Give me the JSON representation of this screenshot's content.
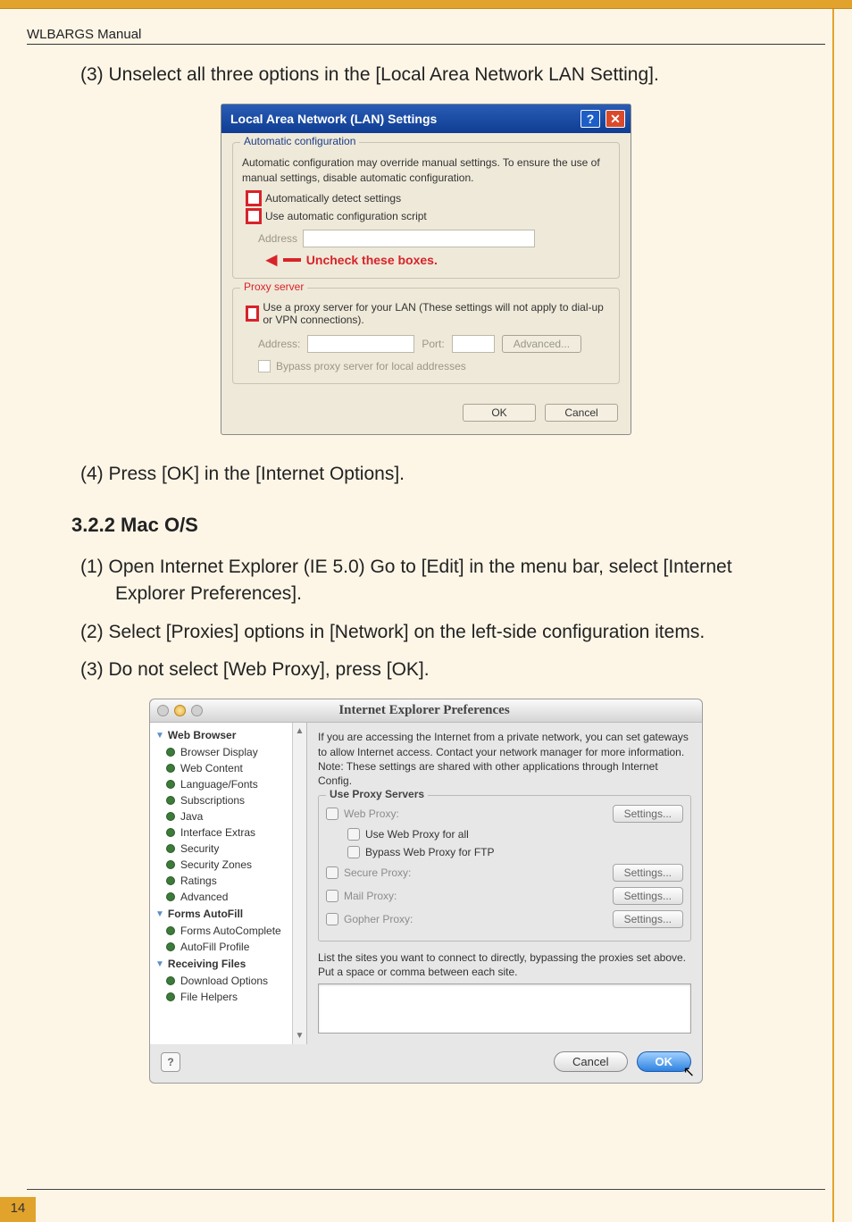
{
  "page": {
    "header_label": "WLBARGS Manual",
    "number": "14"
  },
  "instr3": "(3) Unselect all three options in the  [Local Area Network LAN Setting].",
  "instr4": "(4) Press [OK] in the [Internet Options].",
  "section_heading": "3.2.2 Mac O/S",
  "mac_steps": {
    "s1a": "(1) Open Internet Explorer (IE 5.0) Go to [Edit] in the menu bar, select [Internet",
    "s1b": "Explorer Preferences].",
    "s2": "(2) Select [Proxies] options in [Network] on the left-side configuration items.",
    "s3": "(3) Do not select [Web Proxy], press [OK]."
  },
  "lan": {
    "title": "Local Area Network (LAN) Settings",
    "help": "?",
    "close": "✕",
    "auto_legend": "Automatic configuration",
    "auto_desc": "Automatic configuration may override manual settings.  To ensure the use of manual settings, disable automatic configuration.",
    "auto_detect": "Automatically detect settings",
    "auto_script": "Use automatic configuration script",
    "address_lbl": "Address",
    "uncheck_hint": "Uncheck these boxes.",
    "proxy_legend": "Proxy server",
    "proxy_desc": "Use a proxy server for your LAN (These settings will not apply to dial-up or VPN connections).",
    "addr2": "Address:",
    "port": "Port:",
    "advanced": "Advanced...",
    "bypass": "Bypass proxy server for local addresses",
    "ok": "OK",
    "cancel": "Cancel"
  },
  "mac": {
    "title": "Internet Explorer Preferences",
    "sidebar": {
      "cat1": "Web Browser",
      "items1": [
        "Browser Display",
        "Web Content",
        "Language/Fonts",
        "Subscriptions",
        "Java",
        "Interface Extras",
        "Security",
        "Security Zones",
        "Ratings",
        "Advanced"
      ],
      "cat2": "Forms AutoFill",
      "items2": [
        "Forms AutoComplete",
        "AutoFill Profile"
      ],
      "cat3": "Receiving Files",
      "items3": [
        "Download Options",
        "File Helpers"
      ]
    },
    "intro": "If you are accessing the Internet from a private network, you can set gateways to allow Internet access.  Contact your network manager for more information.  Note: These settings are shared with other applications through Internet Config.",
    "ups_legend": "Use Proxy Servers",
    "web_proxy": "Web Proxy:",
    "use_all": "Use Web Proxy for all",
    "bypass_ftp": "Bypass Web Proxy for FTP",
    "secure": "Secure Proxy:",
    "mail": "Mail Proxy:",
    "gopher": "Gopher Proxy:",
    "settings_btn": "Settings...",
    "bypass_note": "List the sites you want to connect to directly,  bypassing the proxies set above.  Put a space or comma between each site.",
    "help": "?",
    "cancel": "Cancel",
    "ok": "OK"
  }
}
